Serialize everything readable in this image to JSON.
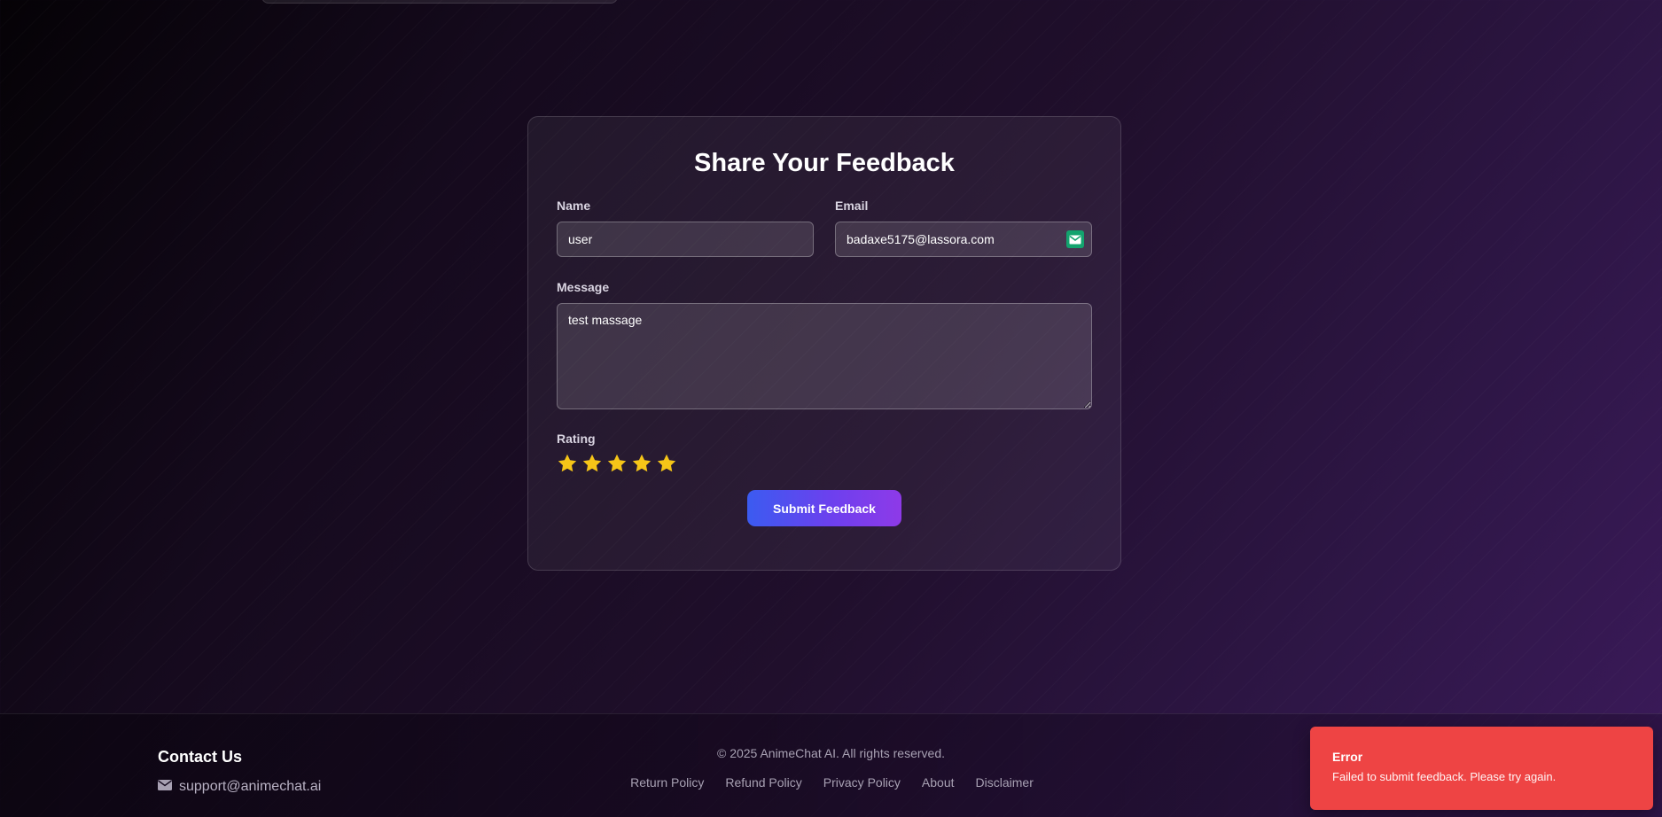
{
  "form": {
    "title": "Share Your Feedback",
    "name_label": "Name",
    "name_value": "user",
    "email_label": "Email",
    "email_value": "badaxe5175@lassora.com",
    "message_label": "Message",
    "message_value": "test massage",
    "rating_label": "Rating",
    "rating_value": 5,
    "rating_max": 5,
    "star_color": "#f5c518",
    "submit_label": "Submit Feedback"
  },
  "footer": {
    "contact_title": "Contact Us",
    "contact_email": "support@animechat.ai",
    "contact_icon": "envelope-icon",
    "copyright": "© 2025 AnimeChat AI. All rights reserved.",
    "links": [
      "Return Policy",
      "Refund Policy",
      "Privacy Policy",
      "About",
      "Disclaimer"
    ]
  },
  "toast": {
    "title": "Error",
    "message": "Failed to submit feedback. Please try again.",
    "color": "#ee4444"
  }
}
